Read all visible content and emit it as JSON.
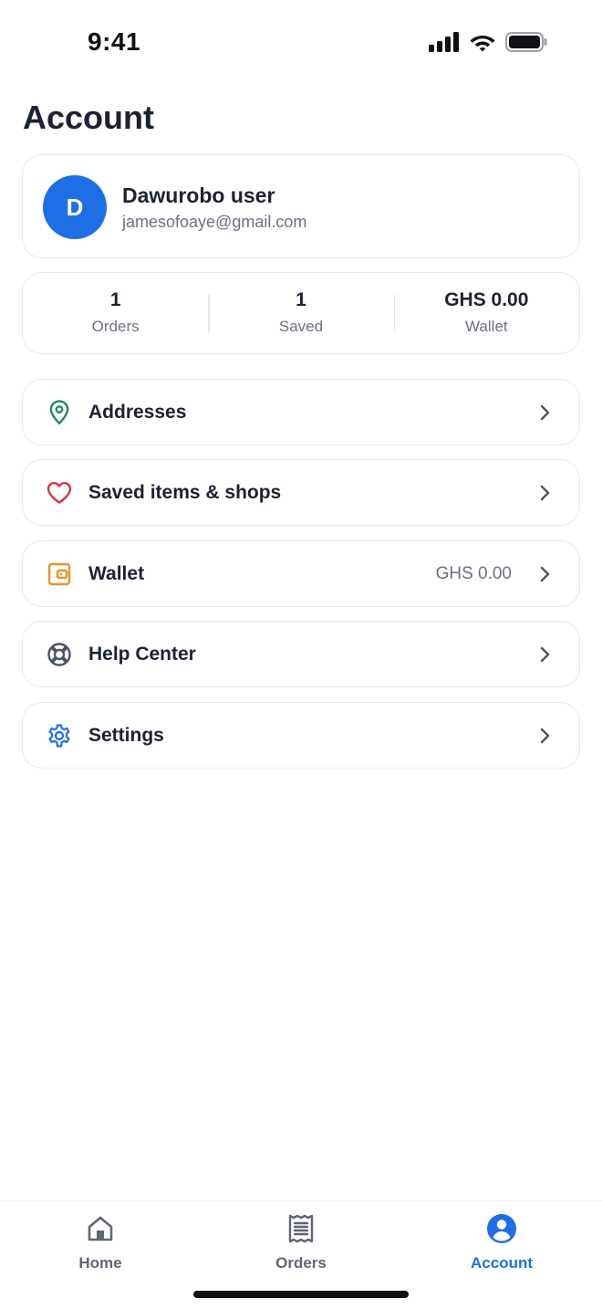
{
  "status_bar": {
    "time": "9:41"
  },
  "page": {
    "title": "Account"
  },
  "profile": {
    "avatar_initial": "D",
    "name": "Dawurobo user",
    "email": "jamesofoaye@gmail.com"
  },
  "stats": [
    {
      "value": "1",
      "label": "Orders"
    },
    {
      "value": "1",
      "label": "Saved"
    },
    {
      "value": "GHS 0.00",
      "label": "Wallet"
    }
  ],
  "menu": [
    {
      "label": "Addresses",
      "icon": "location-pin-icon",
      "value": "",
      "icon_color": "#1f8a5b"
    },
    {
      "label": "Saved items & shops",
      "icon": "heart-icon",
      "value": "",
      "icon_color": "#d6324b"
    },
    {
      "label": "Wallet",
      "icon": "wallet-icon",
      "value": "GHS 0.00",
      "icon_color": "#e8922a"
    },
    {
      "label": "Help Center",
      "icon": "lifebuoy-icon",
      "value": "",
      "icon_color": "#4b5563"
    },
    {
      "label": "Settings",
      "icon": "gear-icon",
      "value": "",
      "icon_color": "#1e6fe6"
    }
  ],
  "tab_bar": {
    "tabs": [
      {
        "label": "Home",
        "icon": "home-icon",
        "active": false
      },
      {
        "label": "Orders",
        "icon": "receipt-icon",
        "active": false
      },
      {
        "label": "Account",
        "icon": "user-circle-icon",
        "active": true
      }
    ]
  },
  "colors": {
    "accent": "#1e6fe6",
    "text_primary": "#1b2233",
    "text_secondary": "#6a7180",
    "border": "#e6e8ee"
  }
}
